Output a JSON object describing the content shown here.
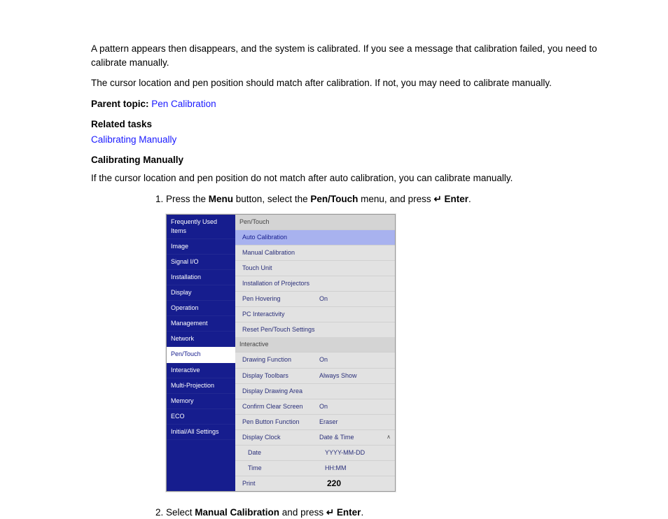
{
  "intro": {
    "para1": "A pattern appears then disappears, and the system is calibrated. If you see a message that calibration failed, you need to calibrate manually.",
    "para2": "The cursor location and pen position should match after calibration. If not, you may need to calibrate manually."
  },
  "parent_topic": {
    "label": "Parent topic:",
    "link": "Pen Calibration"
  },
  "related": {
    "label": "Related tasks",
    "link": "Calibrating Manually"
  },
  "section_heading": "Calibrating Manually",
  "section_intro": "If the cursor location and pen position do not match after auto calibration, you can calibrate manually.",
  "steps": {
    "s1": {
      "pre": "Press the ",
      "b1": "Menu",
      "mid1": " button, select the ",
      "b2": "Pen/Touch",
      "mid2": " menu, and press ",
      "b3": "Enter",
      "post": "."
    },
    "s2": {
      "pre": "Select ",
      "b1": "Manual Calibration",
      "mid": " and press ",
      "b2": "Enter",
      "post": "."
    }
  },
  "menu": {
    "left": [
      "Frequently Used Items",
      "Image",
      "Signal I/O",
      "Installation",
      "Display",
      "Operation",
      "Management",
      "Network",
      "Pen/Touch",
      "Interactive",
      "Multi-Projection",
      "Memory",
      "ECO",
      "Initial/All Settings"
    ],
    "left_selected": "Pen/Touch",
    "right": {
      "sec1": "Pen/Touch",
      "items1": [
        {
          "label": "Auto Calibration",
          "value": "",
          "hl": true
        },
        {
          "label": "Manual Calibration",
          "value": ""
        },
        {
          "label": "Touch Unit",
          "value": ""
        },
        {
          "label": "Installation of Projectors",
          "value": ""
        },
        {
          "label": "Pen Hovering",
          "value": "On"
        },
        {
          "label": "PC Interactivity",
          "value": ""
        },
        {
          "label": "Reset Pen/Touch Settings",
          "value": ""
        }
      ],
      "sec2": "Interactive",
      "items2": [
        {
          "label": "Drawing Function",
          "value": "On"
        },
        {
          "label": "Display Toolbars",
          "value": "Always Show"
        },
        {
          "label": "Display Drawing Area",
          "value": ""
        },
        {
          "label": "Confirm Clear Screen",
          "value": "On"
        },
        {
          "label": "Pen Button Function",
          "value": "Eraser"
        },
        {
          "label": "Display Clock",
          "value": "Date & Time",
          "caret": true
        },
        {
          "label": "Date",
          "value": "YYYY-MM-DD",
          "sub": true
        },
        {
          "label": "Time",
          "value": "HH:MM",
          "sub": true
        },
        {
          "label": "Print",
          "value": ""
        }
      ]
    }
  },
  "page_number": "220",
  "enter_glyph": "↵"
}
